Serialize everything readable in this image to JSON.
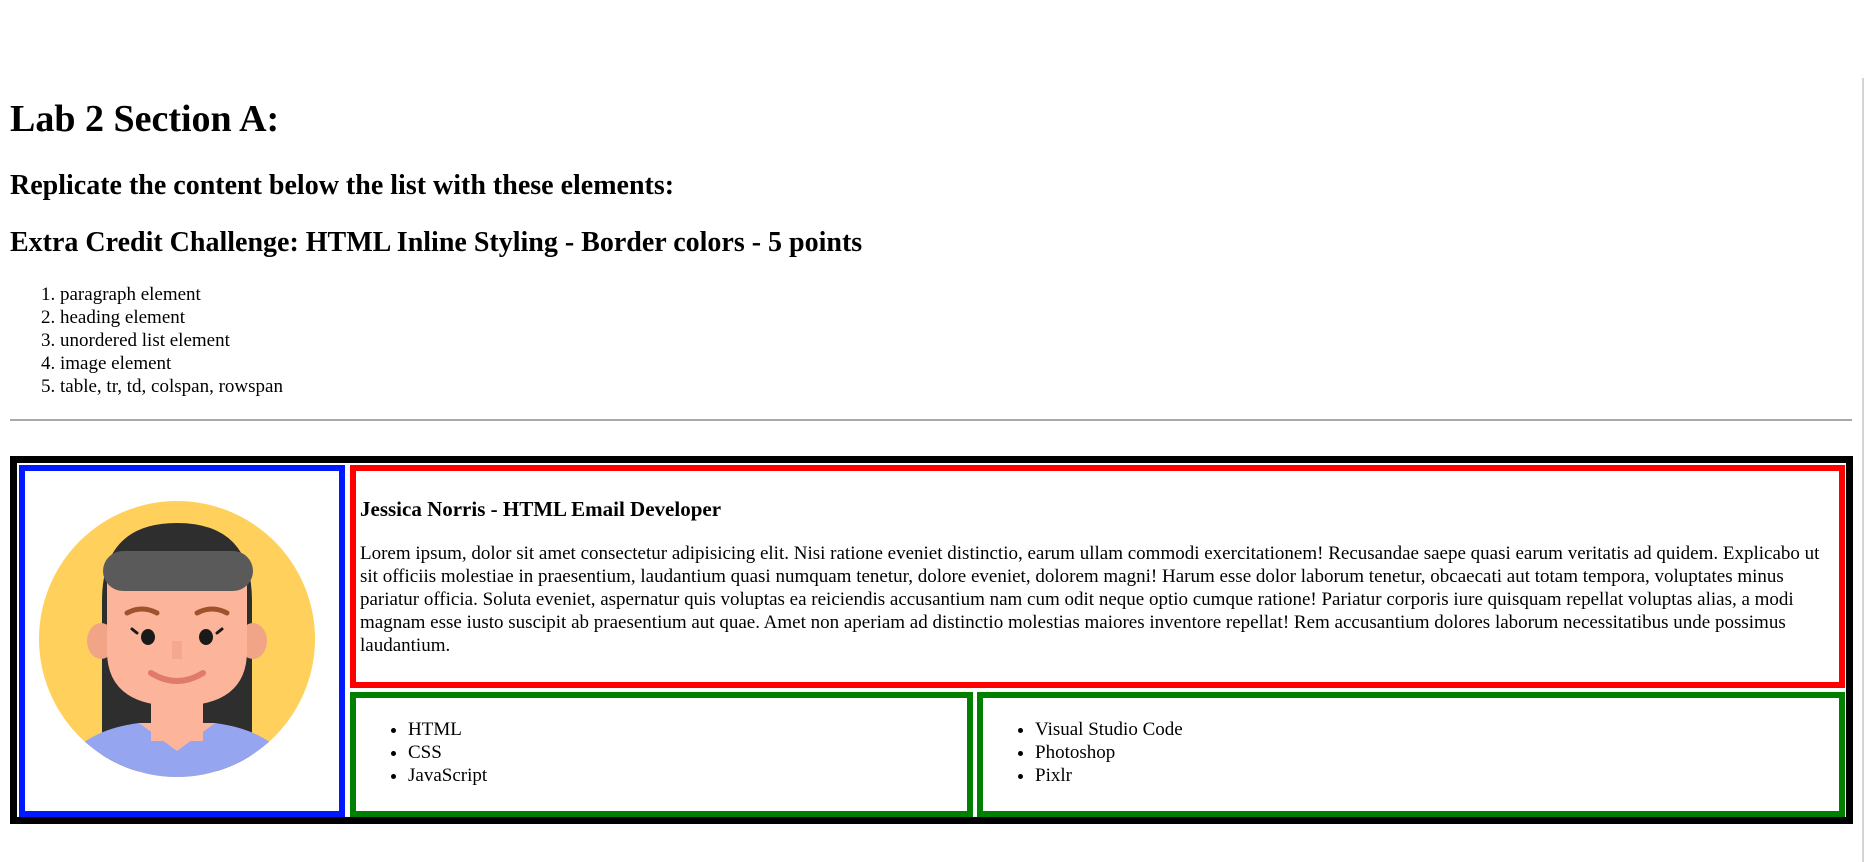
{
  "header": {
    "title": "Lab 2 Section A:",
    "subtitle": "Replicate the content below the list with these elements:",
    "extra_credit": "Extra Credit Challenge: HTML Inline Styling - Border colors - 5 points"
  },
  "requirements": [
    "paragraph element",
    "heading element",
    "unordered list element",
    "image element",
    "table, tr, td, colspan, rowspan"
  ],
  "profile": {
    "name": "Jessica Norris - HTML Email Developer",
    "bio": "Lorem ipsum, dolor sit amet consectetur adipisicing elit. Nisi ratione eveniet distinctio, earum ullam commodi exercitationem! Recusandae saepe quasi earum veritatis ad quidem. Explicabo ut sit officiis molestiae in praesentium, laudantium quasi numquam tenetur, dolore eveniet, dolorem magni! Harum esse dolor laborum tenetur, obcaecati aut totam tempora, voluptates minus pariatur officia. Soluta eveniet, aspernatur quis voluptas ea reiciendis accusantium nam cum odit neque optio cumque ratione! Pariatur corporis iure quisquam repellat voluptas alias, a modi magnam esse iusto suscipit ab praesentium aut quae. Amet non aperiam ad distinctio molestias maiores inventore repellat! Rem accusantium dolores laborum necessitatibus unde possimus laudantium.",
    "skills": [
      "HTML",
      "CSS",
      "JavaScript"
    ],
    "tools": [
      "Visual Studio Code",
      "Photoshop",
      "Pixlr"
    ]
  },
  "colors": {
    "photo_border": "#0019ff",
    "bio_border": "#ff0000",
    "list_border": "#008000",
    "outer_border": "#000000",
    "avatar_bg": "#ffd15c",
    "avatar_skin": "#fcb59a",
    "avatar_hair": "#2e2e2e",
    "avatar_shirt": "#95a5f0"
  },
  "icons": {
    "avatar": "woman-avatar-icon"
  }
}
